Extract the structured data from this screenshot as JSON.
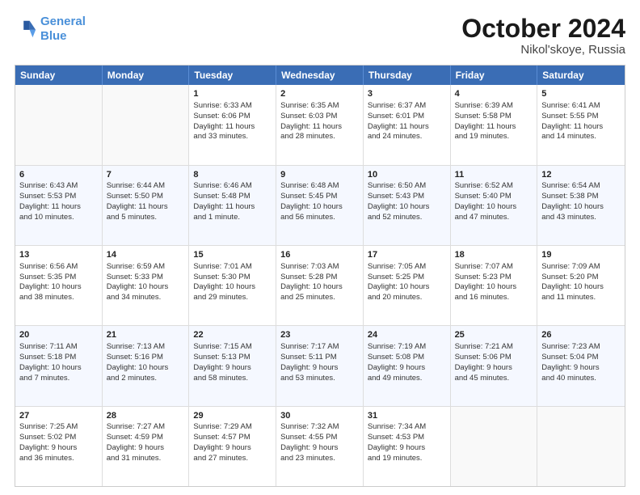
{
  "header": {
    "logo": {
      "line1": "General",
      "line2": "Blue"
    },
    "title": "October 2024",
    "subtitle": "Nikol'skoye, Russia"
  },
  "days": [
    "Sunday",
    "Monday",
    "Tuesday",
    "Wednesday",
    "Thursday",
    "Friday",
    "Saturday"
  ],
  "weeks": [
    [
      {
        "num": "",
        "lines": []
      },
      {
        "num": "",
        "lines": []
      },
      {
        "num": "1",
        "lines": [
          "Sunrise: 6:33 AM",
          "Sunset: 6:06 PM",
          "Daylight: 11 hours",
          "and 33 minutes."
        ]
      },
      {
        "num": "2",
        "lines": [
          "Sunrise: 6:35 AM",
          "Sunset: 6:03 PM",
          "Daylight: 11 hours",
          "and 28 minutes."
        ]
      },
      {
        "num": "3",
        "lines": [
          "Sunrise: 6:37 AM",
          "Sunset: 6:01 PM",
          "Daylight: 11 hours",
          "and 24 minutes."
        ]
      },
      {
        "num": "4",
        "lines": [
          "Sunrise: 6:39 AM",
          "Sunset: 5:58 PM",
          "Daylight: 11 hours",
          "and 19 minutes."
        ]
      },
      {
        "num": "5",
        "lines": [
          "Sunrise: 6:41 AM",
          "Sunset: 5:55 PM",
          "Daylight: 11 hours",
          "and 14 minutes."
        ]
      }
    ],
    [
      {
        "num": "6",
        "lines": [
          "Sunrise: 6:43 AM",
          "Sunset: 5:53 PM",
          "Daylight: 11 hours",
          "and 10 minutes."
        ]
      },
      {
        "num": "7",
        "lines": [
          "Sunrise: 6:44 AM",
          "Sunset: 5:50 PM",
          "Daylight: 11 hours",
          "and 5 minutes."
        ]
      },
      {
        "num": "8",
        "lines": [
          "Sunrise: 6:46 AM",
          "Sunset: 5:48 PM",
          "Daylight: 11 hours",
          "and 1 minute."
        ]
      },
      {
        "num": "9",
        "lines": [
          "Sunrise: 6:48 AM",
          "Sunset: 5:45 PM",
          "Daylight: 10 hours",
          "and 56 minutes."
        ]
      },
      {
        "num": "10",
        "lines": [
          "Sunrise: 6:50 AM",
          "Sunset: 5:43 PM",
          "Daylight: 10 hours",
          "and 52 minutes."
        ]
      },
      {
        "num": "11",
        "lines": [
          "Sunrise: 6:52 AM",
          "Sunset: 5:40 PM",
          "Daylight: 10 hours",
          "and 47 minutes."
        ]
      },
      {
        "num": "12",
        "lines": [
          "Sunrise: 6:54 AM",
          "Sunset: 5:38 PM",
          "Daylight: 10 hours",
          "and 43 minutes."
        ]
      }
    ],
    [
      {
        "num": "13",
        "lines": [
          "Sunrise: 6:56 AM",
          "Sunset: 5:35 PM",
          "Daylight: 10 hours",
          "and 38 minutes."
        ]
      },
      {
        "num": "14",
        "lines": [
          "Sunrise: 6:59 AM",
          "Sunset: 5:33 PM",
          "Daylight: 10 hours",
          "and 34 minutes."
        ]
      },
      {
        "num": "15",
        "lines": [
          "Sunrise: 7:01 AM",
          "Sunset: 5:30 PM",
          "Daylight: 10 hours",
          "and 29 minutes."
        ]
      },
      {
        "num": "16",
        "lines": [
          "Sunrise: 7:03 AM",
          "Sunset: 5:28 PM",
          "Daylight: 10 hours",
          "and 25 minutes."
        ]
      },
      {
        "num": "17",
        "lines": [
          "Sunrise: 7:05 AM",
          "Sunset: 5:25 PM",
          "Daylight: 10 hours",
          "and 20 minutes."
        ]
      },
      {
        "num": "18",
        "lines": [
          "Sunrise: 7:07 AM",
          "Sunset: 5:23 PM",
          "Daylight: 10 hours",
          "and 16 minutes."
        ]
      },
      {
        "num": "19",
        "lines": [
          "Sunrise: 7:09 AM",
          "Sunset: 5:20 PM",
          "Daylight: 10 hours",
          "and 11 minutes."
        ]
      }
    ],
    [
      {
        "num": "20",
        "lines": [
          "Sunrise: 7:11 AM",
          "Sunset: 5:18 PM",
          "Daylight: 10 hours",
          "and 7 minutes."
        ]
      },
      {
        "num": "21",
        "lines": [
          "Sunrise: 7:13 AM",
          "Sunset: 5:16 PM",
          "Daylight: 10 hours",
          "and 2 minutes."
        ]
      },
      {
        "num": "22",
        "lines": [
          "Sunrise: 7:15 AM",
          "Sunset: 5:13 PM",
          "Daylight: 9 hours",
          "and 58 minutes."
        ]
      },
      {
        "num": "23",
        "lines": [
          "Sunrise: 7:17 AM",
          "Sunset: 5:11 PM",
          "Daylight: 9 hours",
          "and 53 minutes."
        ]
      },
      {
        "num": "24",
        "lines": [
          "Sunrise: 7:19 AM",
          "Sunset: 5:08 PM",
          "Daylight: 9 hours",
          "and 49 minutes."
        ]
      },
      {
        "num": "25",
        "lines": [
          "Sunrise: 7:21 AM",
          "Sunset: 5:06 PM",
          "Daylight: 9 hours",
          "and 45 minutes."
        ]
      },
      {
        "num": "26",
        "lines": [
          "Sunrise: 7:23 AM",
          "Sunset: 5:04 PM",
          "Daylight: 9 hours",
          "and 40 minutes."
        ]
      }
    ],
    [
      {
        "num": "27",
        "lines": [
          "Sunrise: 7:25 AM",
          "Sunset: 5:02 PM",
          "Daylight: 9 hours",
          "and 36 minutes."
        ]
      },
      {
        "num": "28",
        "lines": [
          "Sunrise: 7:27 AM",
          "Sunset: 4:59 PM",
          "Daylight: 9 hours",
          "and 31 minutes."
        ]
      },
      {
        "num": "29",
        "lines": [
          "Sunrise: 7:29 AM",
          "Sunset: 4:57 PM",
          "Daylight: 9 hours",
          "and 27 minutes."
        ]
      },
      {
        "num": "30",
        "lines": [
          "Sunrise: 7:32 AM",
          "Sunset: 4:55 PM",
          "Daylight: 9 hours",
          "and 23 minutes."
        ]
      },
      {
        "num": "31",
        "lines": [
          "Sunrise: 7:34 AM",
          "Sunset: 4:53 PM",
          "Daylight: 9 hours",
          "and 19 minutes."
        ]
      },
      {
        "num": "",
        "lines": []
      },
      {
        "num": "",
        "lines": []
      }
    ]
  ]
}
